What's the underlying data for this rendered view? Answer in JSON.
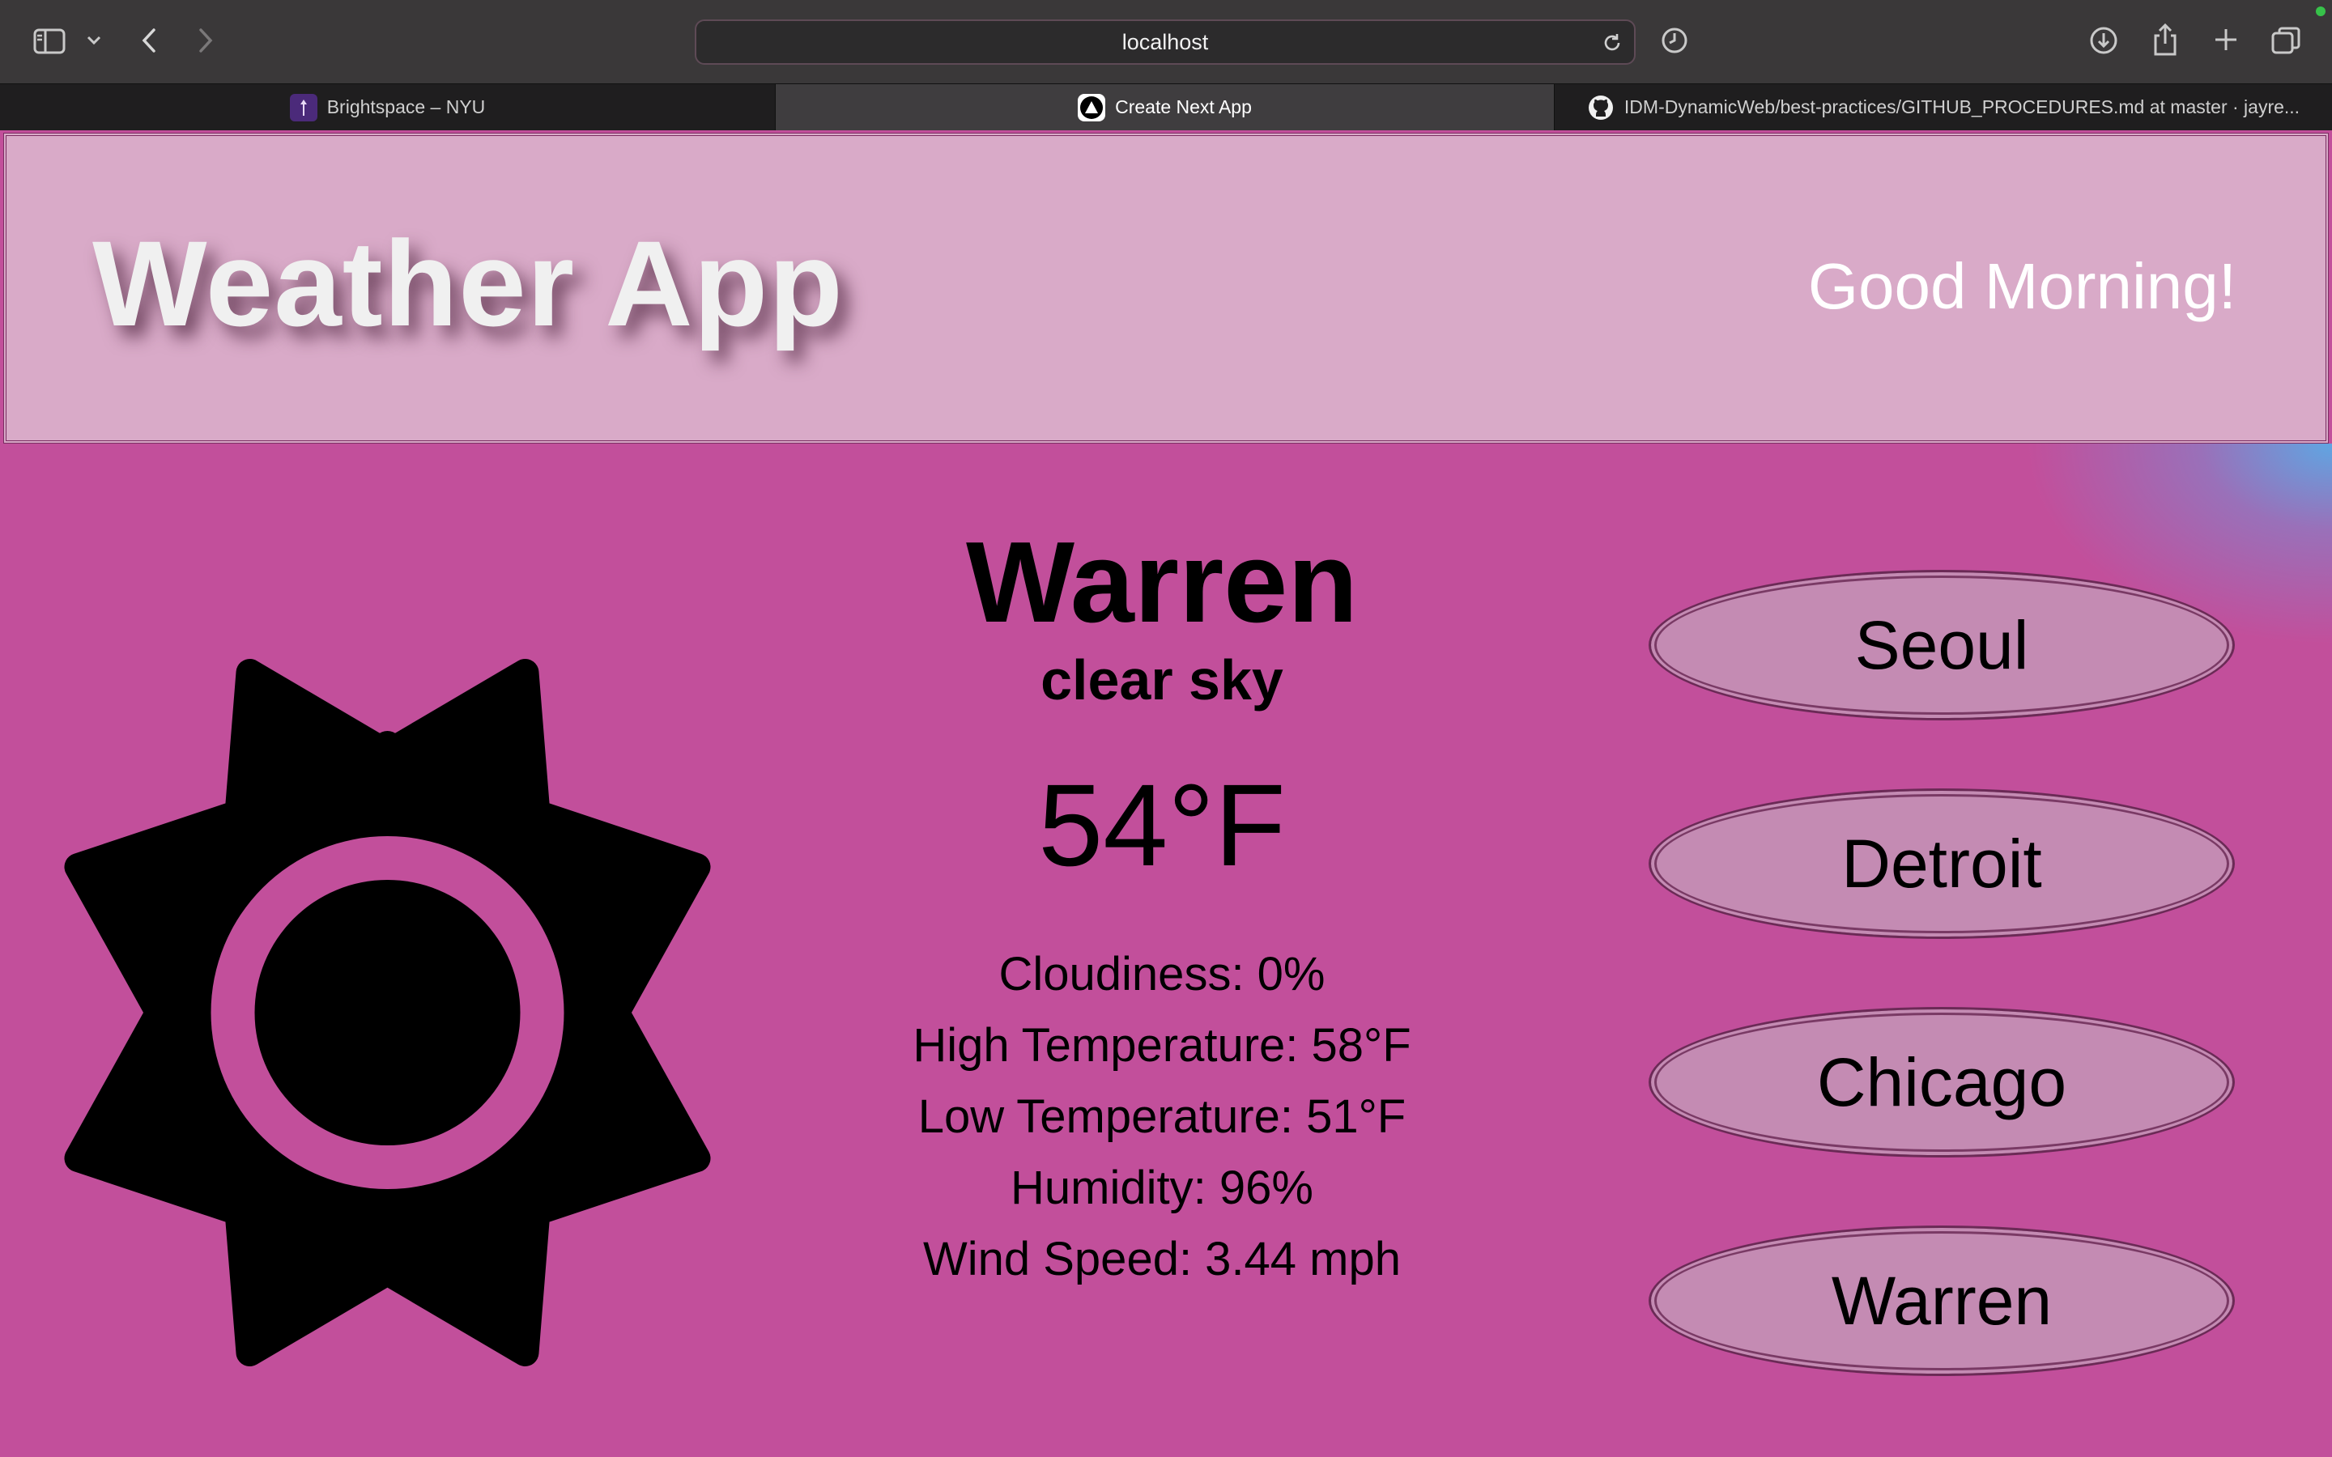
{
  "browser": {
    "url": "localhost",
    "tabs": [
      {
        "label": "Brightspace – NYU",
        "active": false
      },
      {
        "label": "Create Next App",
        "active": true
      },
      {
        "label": "IDM-DynamicWeb/best-practices/GITHUB_PROCEDURES.md at master · jayre...",
        "active": false
      }
    ],
    "icons": [
      "sidebar-icon",
      "chevron-down-icon",
      "back-icon",
      "forward-icon",
      "reload-icon",
      "history-icon",
      "download-icon",
      "share-icon",
      "new-tab-icon",
      "tab-overview-icon"
    ]
  },
  "header": {
    "title": "Weather App",
    "greeting": "Good Morning!"
  },
  "weather": {
    "icon": "sun-icon",
    "city": "Warren",
    "condition": "clear sky",
    "temperature": "54°F",
    "details": {
      "cloudiness": "Cloudiness: 0%",
      "high": "High Temperature: 58°F",
      "low": "Low Temperature: 51°F",
      "humidity": "Humidity: 96%",
      "wind": "Wind Speed: 3.44 mph"
    }
  },
  "cities": [
    {
      "label": "Seoul"
    },
    {
      "label": "Detroit"
    },
    {
      "label": "Chicago"
    },
    {
      "label": "Warren"
    }
  ],
  "colors": {
    "page_background": "#c24f9b",
    "header_background": "#d9aac8",
    "button_background": "#c48bb3",
    "text": "#000000"
  }
}
